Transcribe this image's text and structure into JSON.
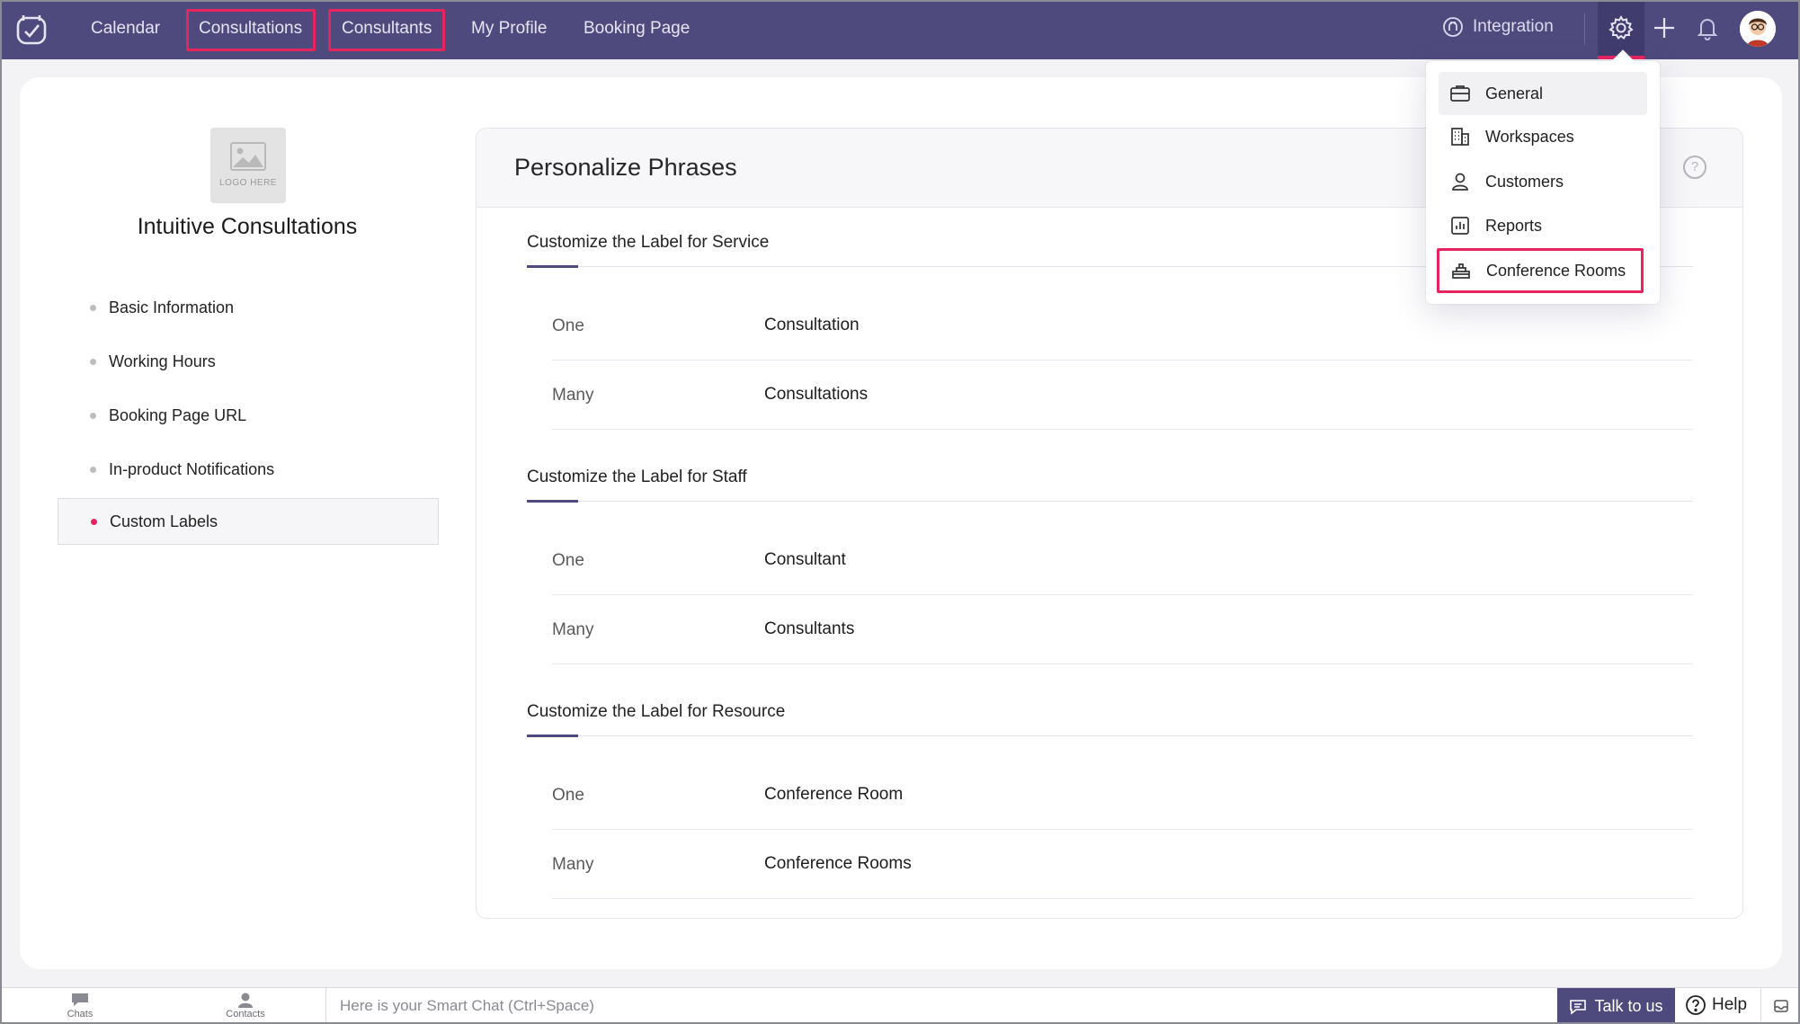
{
  "nav": {
    "items": [
      "Calendar",
      "Consultations",
      "Consultants",
      "My Profile",
      "Booking Page"
    ],
    "integration": "Integration"
  },
  "sidebar": {
    "logo_placeholder": "LOGO HERE",
    "org_name": "Intuitive Consultations",
    "items": [
      {
        "label": "Basic Information",
        "active": false
      },
      {
        "label": "Working Hours",
        "active": false
      },
      {
        "label": "Booking Page URL",
        "active": false
      },
      {
        "label": "In-product Notifications",
        "active": false
      },
      {
        "label": "Custom Labels",
        "active": true
      }
    ]
  },
  "main": {
    "title": "Personalize Phrases",
    "help": "?",
    "sections": [
      {
        "title": "Customize the Label for Service",
        "rows": [
          {
            "label": "One",
            "value": "Consultation"
          },
          {
            "label": "Many",
            "value": "Consultations"
          }
        ]
      },
      {
        "title": "Customize the Label for Staff",
        "rows": [
          {
            "label": "One",
            "value": "Consultant"
          },
          {
            "label": "Many",
            "value": "Consultants"
          }
        ]
      },
      {
        "title": "Customize the Label for Resource",
        "rows": [
          {
            "label": "One",
            "value": "Conference Room"
          },
          {
            "label": "Many",
            "value": "Conference Rooms"
          }
        ]
      }
    ]
  },
  "settings_menu": {
    "items": [
      {
        "label": "General",
        "icon": "briefcase-icon"
      },
      {
        "label": "Workspaces",
        "icon": "building-icon"
      },
      {
        "label": "Customers",
        "icon": "user-icon"
      },
      {
        "label": "Reports",
        "icon": "bar-chart-icon"
      },
      {
        "label": "Conference Rooms",
        "icon": "conference-room-icon"
      }
    ]
  },
  "bottom": {
    "chats": "Chats",
    "contacts": "Contacts",
    "smart_chat_placeholder": "Here is your Smart Chat (Ctrl+Space)",
    "talk": "Talk to us",
    "help": "Help"
  },
  "colors": {
    "topbar": "#4f4a7e",
    "accent": "#e8245f"
  }
}
